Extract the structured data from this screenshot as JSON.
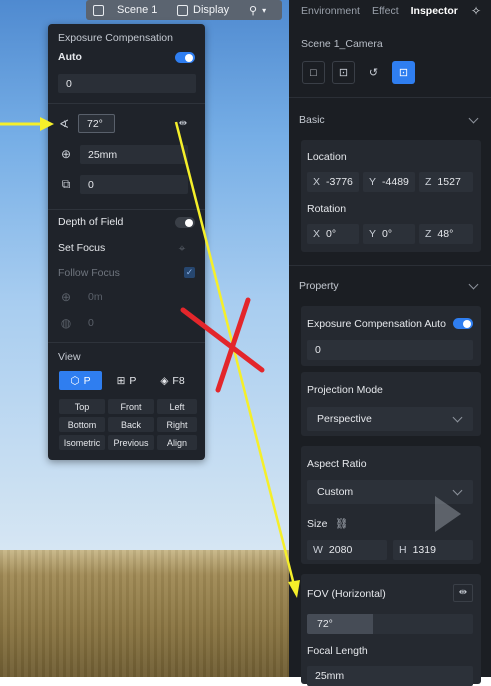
{
  "viewport_toolbar": {
    "scene_label": "Scene 1",
    "display_label": "Display"
  },
  "camera_popup": {
    "exposure": {
      "title": "Exposure Compensation",
      "auto_label": "Auto",
      "auto_on": true,
      "value": "0"
    },
    "fov_value": "72°",
    "focal_value": "25mm",
    "sensor_value": "0",
    "depth_of_field_label": "Depth of Field",
    "depth_of_field_on": false,
    "set_focus_label": "Set Focus",
    "follow_focus_label": "Follow Focus",
    "focus_distance": "0m",
    "aperture": "0",
    "view": {
      "title": "View",
      "mode_buttons": [
        {
          "label": "P",
          "icon": "perspective-cube-icon"
        },
        {
          "label": "P",
          "icon": "grid-icon"
        },
        {
          "label": "F8",
          "icon": "diamond-icon"
        }
      ],
      "grid": [
        "Top",
        "Front",
        "Left",
        "Bottom",
        "Back",
        "Right",
        "Isometric",
        "Previous",
        "Align"
      ]
    }
  },
  "inspector": {
    "tabs": [
      "Environment",
      "Effect",
      "Inspector"
    ],
    "active_tab": "Inspector",
    "object_name": "Scene 1_Camera",
    "basic": {
      "title": "Basic",
      "location_label": "Location",
      "location": {
        "x": "-3776",
        "y": "-4489",
        "z": "1527"
      },
      "rotation_label": "Rotation",
      "rotation": {
        "x": "0°",
        "y": "0°",
        "z": "48°"
      }
    },
    "property": {
      "title": "Property",
      "exposure_label": "Exposure Compensation Auto",
      "exposure_auto_on": true,
      "exposure_value": "0",
      "projection_label": "Projection Mode",
      "projection_value": "Perspective",
      "aspect_label": "Aspect Ratio",
      "aspect_value": "Custom",
      "size_label": "Size",
      "size": {
        "w": "2080",
        "h": "1319"
      },
      "fov_label": "FOV (Horizontal)",
      "fov_value": "72°",
      "fov_fill_fraction": 0.4,
      "focal_label": "Focal Length",
      "focal_value": "25mm"
    }
  },
  "axis_letters": {
    "x": "X",
    "y": "Y",
    "z": "Z",
    "w": "W",
    "h": "H"
  },
  "colors": {
    "accent": "#2f7ef0",
    "annotation_arrow": "#f5ef2a",
    "annotation_cross": "#e3262b"
  }
}
